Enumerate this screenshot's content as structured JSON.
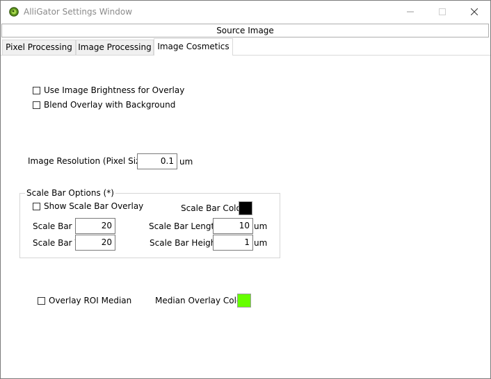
{
  "window": {
    "title": "AlliGator Settings Window"
  },
  "source_bar": {
    "label": "Source Image"
  },
  "tabs": [
    {
      "label": "Pixel Processing",
      "active": false
    },
    {
      "label": "Image Processing",
      "active": false
    },
    {
      "label": "Image Cosmetics",
      "active": true
    }
  ],
  "overlay": {
    "brightness_label": "Use Image Brightness for Overlay",
    "brightness_checked": false,
    "blend_label": "Blend Overlay with Background",
    "blend_checked": false
  },
  "resolution": {
    "label": "Image Resolution (Pixel Size)",
    "value": "0.1",
    "unit": "um"
  },
  "scale_bar": {
    "legend": "Scale Bar Options (*)",
    "show_label": "Show Scale Bar Overlay",
    "show_checked": false,
    "color_label": "Scale Bar Color",
    "color": "#000000",
    "x_label": "Scale Bar X",
    "x_value": "20",
    "y_label": "Scale Bar Y",
    "y_value": "20",
    "length_label": "Scale Bar Length",
    "length_value": "10",
    "length_unit": "um",
    "height_label": "Scale Bar Height",
    "height_value": "1",
    "height_unit": "um"
  },
  "roi": {
    "median_label": "Overlay ROI Median",
    "median_checked": false,
    "color_label": "Median Overlay Color",
    "color": "#66ff00"
  }
}
